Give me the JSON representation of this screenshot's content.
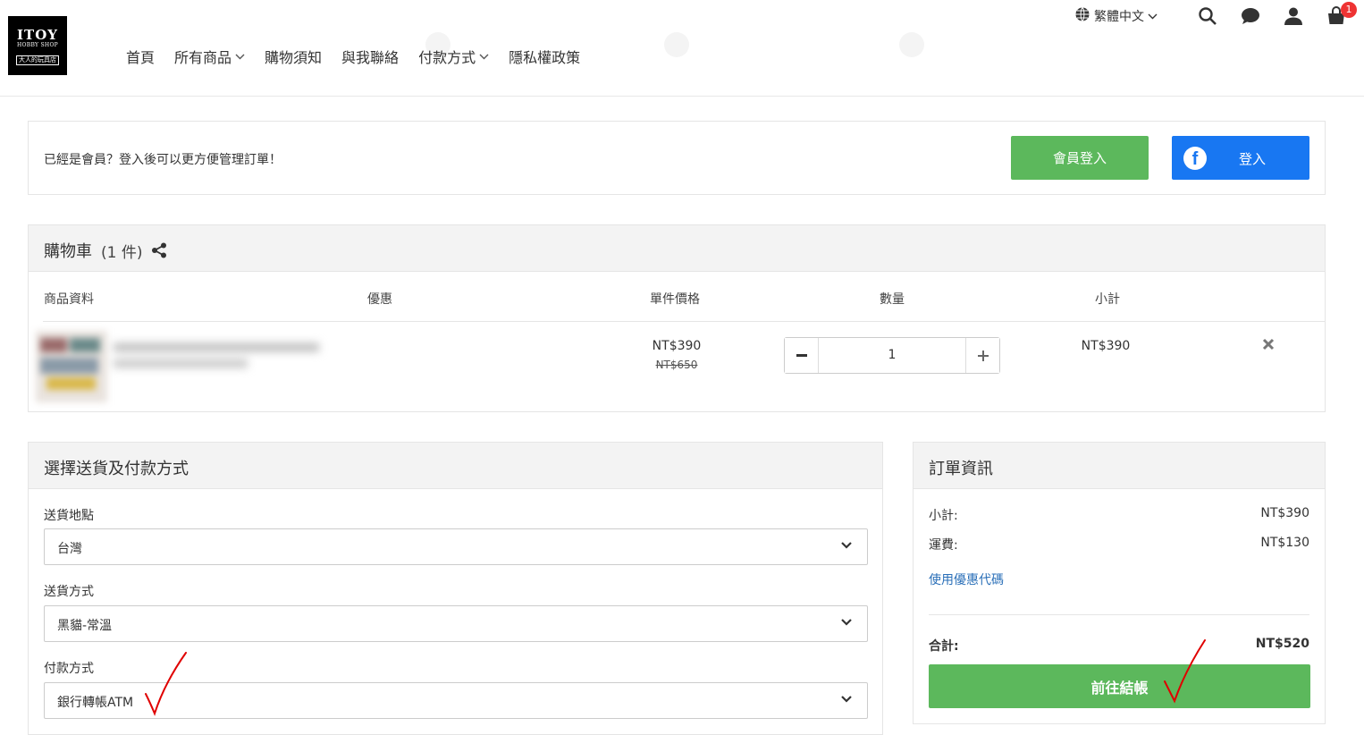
{
  "header": {
    "logo": {
      "line1": "ITOY",
      "line2": "HOBBY SHOP",
      "line3": "大人的玩具店"
    },
    "nav": [
      {
        "label": "首頁",
        "has_dropdown": false
      },
      {
        "label": "所有商品",
        "has_dropdown": true
      },
      {
        "label": "購物須知",
        "has_dropdown": false
      },
      {
        "label": "與我聯絡",
        "has_dropdown": false
      },
      {
        "label": "付款方式",
        "has_dropdown": true
      },
      {
        "label": "隱私權政策",
        "has_dropdown": false
      }
    ],
    "language": "繁體中文",
    "cart_badge": "1",
    "icons": [
      "globe-icon",
      "search-icon",
      "chat-icon",
      "user-icon",
      "shopping-bag-icon"
    ]
  },
  "login_bar": {
    "message": "已經是會員？登入後可以更方便管理訂單！",
    "member_login": "會員登入",
    "fb_login": "登入"
  },
  "cart": {
    "title": "購物車",
    "count": "(1 件)",
    "columns": {
      "product": "商品資料",
      "discount": "優惠",
      "unit_price": "單件價格",
      "quantity": "數量",
      "subtotal": "小計"
    },
    "items": [
      {
        "price": "NT$390",
        "original_price": "NT$650",
        "quantity": "1",
        "subtotal": "NT$390"
      }
    ]
  },
  "shipping": {
    "title": "選擇送貨及付款方式",
    "destination_label": "送貨地點",
    "destination_value": "台灣",
    "method_label": "送貨方式",
    "method_value": "黑貓-常溫",
    "payment_label": "付款方式",
    "payment_value": "銀行轉帳ATM"
  },
  "order": {
    "title": "訂單資訊",
    "subtotal_label": "小計:",
    "subtotal_value": "NT$390",
    "shipping_label": "運費:",
    "shipping_value": "NT$130",
    "coupon_link": "使用優惠代碼",
    "total_label": "合計:",
    "total_value": "NT$520",
    "checkout_button": "前往結帳"
  },
  "colors": {
    "green": "#5cb85c",
    "facebook_blue": "#1877f2",
    "link_blue": "#2a6fb8",
    "badge_red": "#ee3333",
    "annotation_red": "#e00000"
  }
}
